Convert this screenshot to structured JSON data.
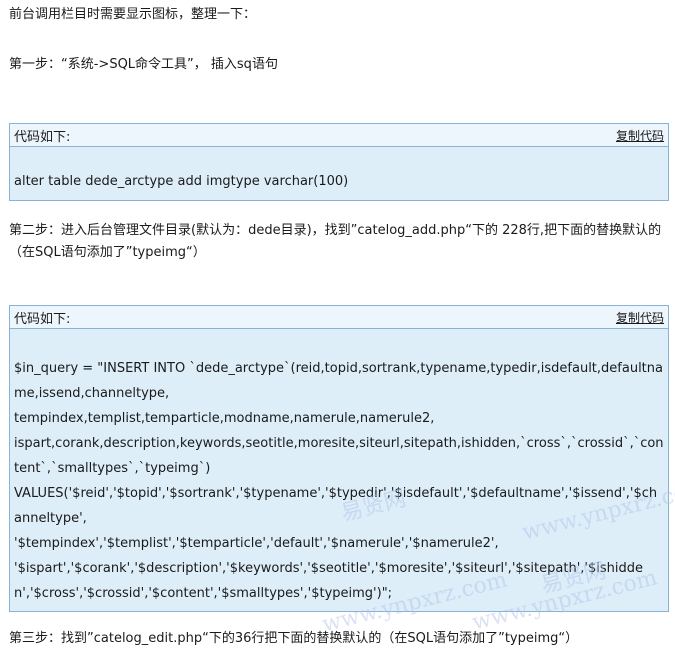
{
  "intro": "前台调用栏目时需要显示图标，整理一下：",
  "step1": "第一步：“系统->SQL命令工具”， 插入sq语句",
  "code1": {
    "title": "代码如下:",
    "copy": "复制代码",
    "lines": [
      "alter table dede_arctype add imgtype varchar(100)"
    ]
  },
  "step2": "第二步：进入后台管理文件目录(默认为：dede目录)，找到”catelog_add.php“下的 228行,把下面的替换默认的（在SQL语句添加了”typeimg“）",
  "code2": {
    "title": "代码如下:",
    "copy": "复制代码",
    "lines": [
      "$in_query = \"INSERT INTO `dede_arctype`(reid,topid,sortrank,typename,typedir,isdefault,defaultname,issend,channeltype,",
      "tempindex,templist,temparticle,modname,namerule,namerule2,",
      "ispart,corank,description,keywords,seotitle,moresite,siteurl,sitepath,ishidden,`cross`,`crossid`,`content`,`smalltypes`,`typeimg`)",
      "VALUES('$reid','$topid','$sortrank','$typename','$typedir','$isdefault','$defaultname','$issend','$channeltype',",
      "'$tempindex','$templist','$temparticle','default','$namerule','$namerule2',",
      "'$ispart','$corank','$description','$keywords','$seotitle','$moresite','$siteurl','$sitepath','$ishidden','$cross','$crossid','$content','$smalltypes','$typeimg')\";"
    ]
  },
  "step3": "第三步：找到”catelog_edit.php“下的36行把下面的替换默认的（在SQL语句添加了”typeimg“）",
  "watermarks": [
    "易贤网",
    "www.ynpxrz.com"
  ]
}
